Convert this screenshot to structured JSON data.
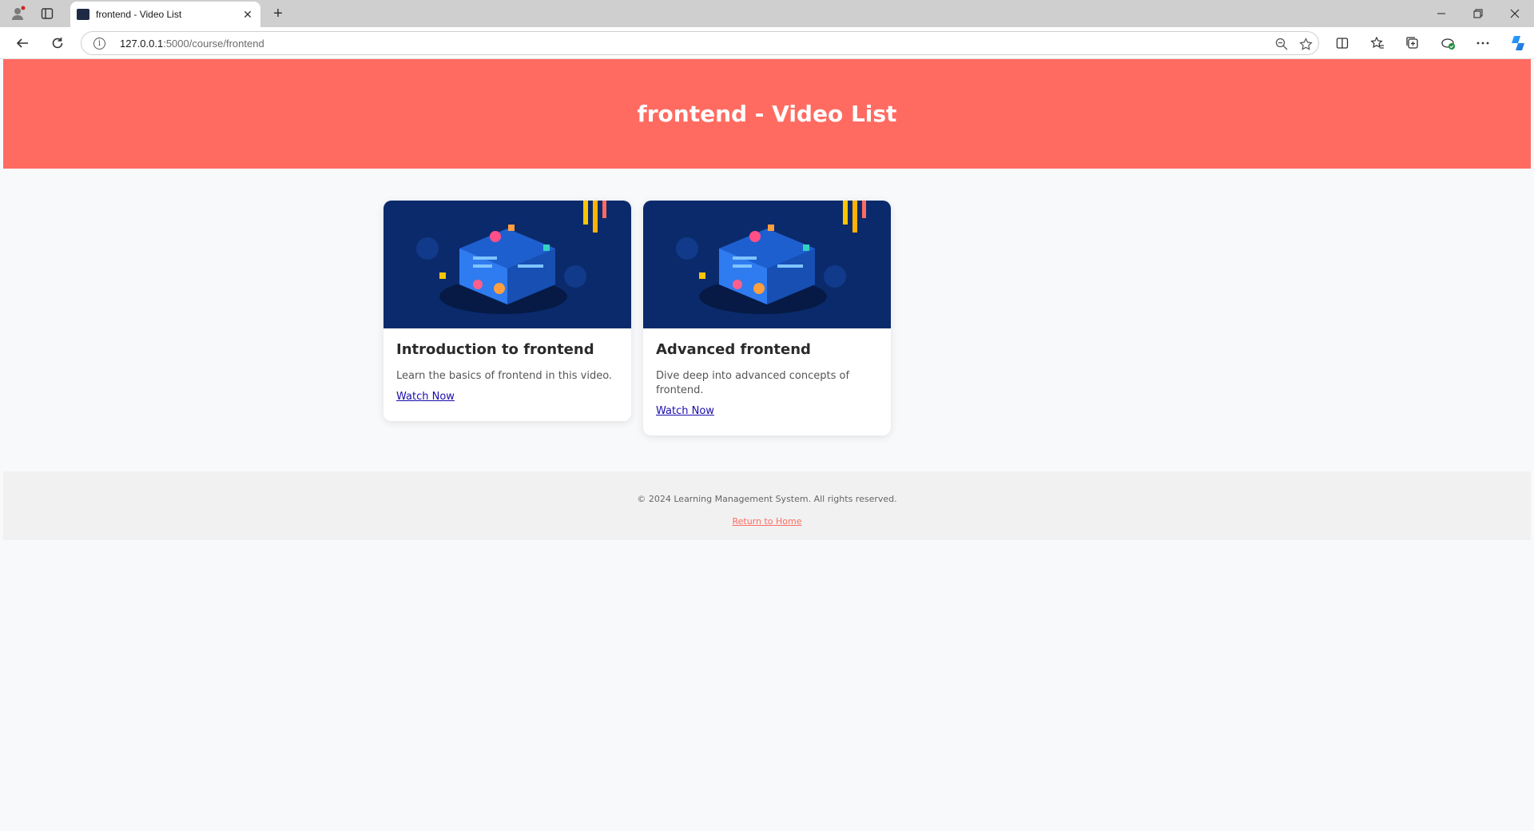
{
  "browser": {
    "tab_title": "frontend - Video List",
    "url_host": "127.0.0.1",
    "url_path": ":5000/course/frontend",
    "icons": [
      "profile-icon",
      "workspaces-icon",
      "back-icon",
      "refresh-icon",
      "info-icon",
      "zoom-out-icon",
      "favorite-star-icon",
      "split-screen-icon",
      "favorites-icon",
      "collections-icon",
      "extensions-icon",
      "more-icon",
      "copilot-icon",
      "minimize-icon",
      "restore-icon",
      "close-window-icon"
    ]
  },
  "header": {
    "title": "frontend - Video List"
  },
  "videos": [
    {
      "title": "Introduction to frontend",
      "description": "Learn the basics of frontend in this video.",
      "link_label": "Watch Now"
    },
    {
      "title": "Advanced frontend",
      "description": "Dive deep into advanced concepts of frontend.",
      "link_label": "Watch Now"
    }
  ],
  "footer": {
    "copyright": "© 2024 Learning Management System. All rights reserved.",
    "home_link": "Return to Home"
  },
  "colors": {
    "accent": "#ff6b61",
    "link": "#1a0dab",
    "thumb_bg": "#0a2a6b"
  }
}
